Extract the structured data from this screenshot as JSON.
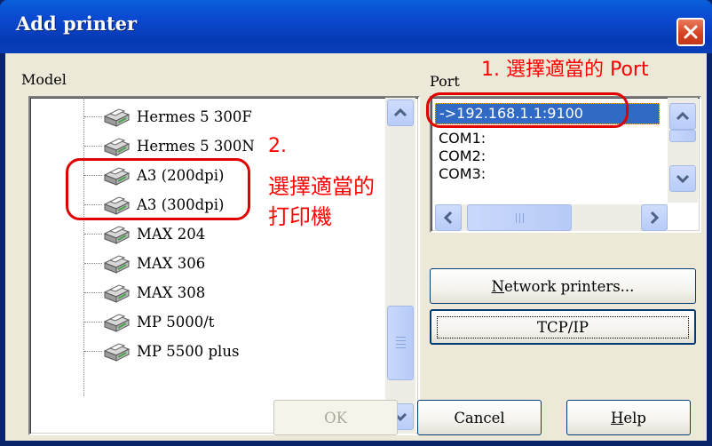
{
  "window": {
    "title": "Add printer"
  },
  "model": {
    "label": "Model",
    "items": [
      "Hermes 5 300F",
      "Hermes 5 300N",
      "A3  (200dpi)",
      "A3  (300dpi)",
      "MAX 204",
      "MAX 306",
      "MAX 308",
      "MP 5000/t",
      "MP 5500 plus"
    ]
  },
  "port": {
    "label": "Port",
    "items": [
      "->192.168.1.1:9100",
      "COM1:",
      "COM2:",
      "COM3:"
    ],
    "selected_index": 0
  },
  "buttons": {
    "network_printers": {
      "prefix": "N",
      "rest": "etwork printers..."
    },
    "tcpip": "TCP/IP",
    "ok": "OK",
    "cancel": "Cancel",
    "help": {
      "prefix": "H",
      "rest": "elp"
    }
  },
  "annotations": {
    "step1": "1. 選擇適當的 Port",
    "step2_num": "2.",
    "step2_line1": "選擇適當的",
    "step2_line2": "打印機"
  },
  "colors": {
    "annotation": "#ff0000",
    "selection": "#316ac5",
    "title_bar": "#0a49d0"
  },
  "icons": [
    "printer-icon",
    "close-icon",
    "scroll-up-icon",
    "scroll-down-icon",
    "scroll-left-icon",
    "scroll-right-icon"
  ]
}
